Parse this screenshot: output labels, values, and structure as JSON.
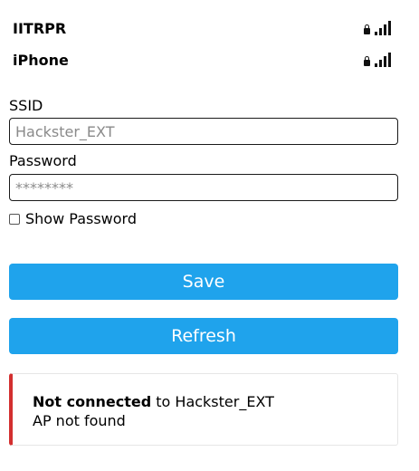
{
  "networks": [
    {
      "ssid": "IITRPR",
      "locked": true,
      "signal": "full"
    },
    {
      "ssid": "iPhone",
      "locked": true,
      "signal": "full"
    }
  ],
  "form": {
    "ssid_label": "SSID",
    "ssid_placeholder": "Hackster_EXT",
    "password_label": "Password",
    "password_placeholder": "********",
    "show_password_label": "Show Password",
    "show_password_checked": false
  },
  "buttons": {
    "save_label": "Save",
    "refresh_label": "Refresh"
  },
  "status": {
    "state": "Not connected",
    "connector": "to",
    "ssid": "Hackster_EXT",
    "detail": "AP not found"
  },
  "colors": {
    "button": "#1fa3ec",
    "status_accent": "#d32f2f"
  }
}
